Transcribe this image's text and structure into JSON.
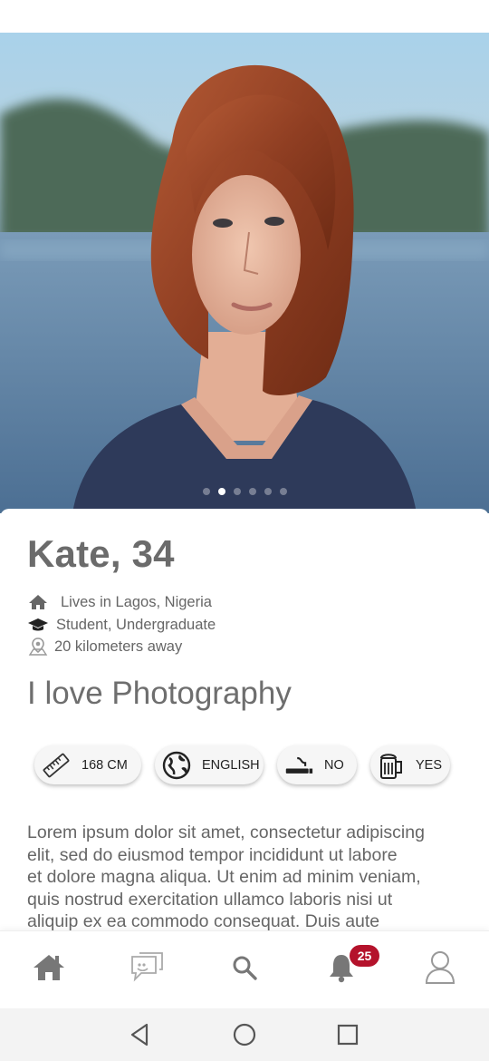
{
  "profile": {
    "name_age": "Kate, 34",
    "location": "Lives in Lagos, Nigeria",
    "education": "Student, Undergraduate",
    "distance": "20 kilometers away",
    "tagline": "I love Photography",
    "photo_count": 6,
    "active_photo": 2
  },
  "attributes": {
    "height": "168 CM",
    "language": "ENGLISH",
    "smoking": "NO",
    "drinking": "YES"
  },
  "bio": "Lorem ipsum dolor sit amet, consectetur adipiscing\nelit, sed do eiusmod tempor incididunt ut labore\net dolore magna aliqua. Ut enim ad minim veniam,\nquis nostrud exercitation ullamco laboris nisi ut\naliquip ex ea commodo consequat. Duis aute",
  "nav": {
    "notifications_badge": "25",
    "icons": [
      "home-icon",
      "chat-icon",
      "search-icon",
      "bell-icon",
      "profile-icon"
    ]
  },
  "colors": {
    "accent": "#b4122b",
    "text": "#666666",
    "icon": "#777777"
  }
}
